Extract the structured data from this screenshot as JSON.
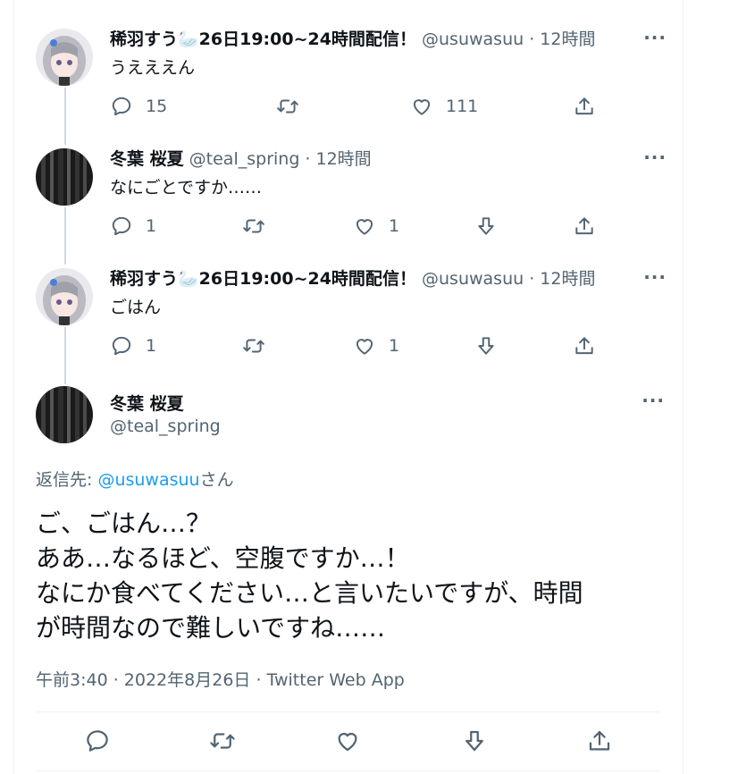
{
  "tweets": [
    {
      "name": "稀羽すう🦢26日19:00~24時間配信！",
      "handle": "@usuwasuu · 12時間",
      "text": "うえええん",
      "reply_count": "15",
      "like_count": "111"
    },
    {
      "name": "冬葉 桜夏",
      "handle": "@teal_spring · 12時間",
      "text": "なにごとですか……",
      "reply_count": "1",
      "like_count": "1"
    },
    {
      "name": "稀羽すう🦢26日19:00~24時間配信！",
      "handle": "@usuwasuu · 12時間",
      "text": "ごはん",
      "reply_count": "1",
      "like_count": "1"
    }
  ],
  "focused": {
    "name": "冬葉 桜夏",
    "handle": "@teal_spring",
    "reply_prefix": "返信先: ",
    "reply_handle": "@usuwasuu",
    "reply_suffix": "さん",
    "lines": [
      "ご、ごはん…？",
      "ああ…なるほど、空腹ですか…！",
      "なにか食べてください…と言いたいですが、時間",
      "が時間なので難しいですね……"
    ],
    "meta": "午前3:40 · 2022年8月26日 · Twitter Web App"
  },
  "more_label": "···",
  "colors": {
    "accent": "#1d9bf0",
    "muted": "#536471",
    "line": "#cfd9de"
  },
  "icons": [
    "reply-icon",
    "retweet-icon",
    "like-icon",
    "downvote-icon",
    "share-icon",
    "more-icon"
  ]
}
